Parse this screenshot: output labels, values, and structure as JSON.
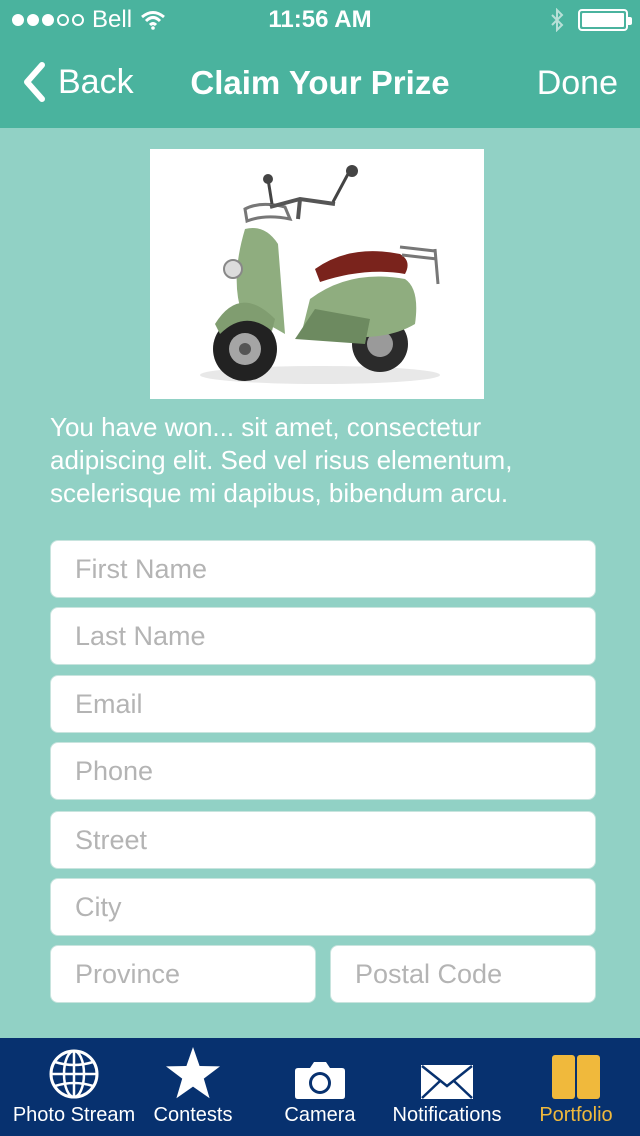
{
  "status_bar": {
    "carrier": "Bell",
    "time": "11:56 AM"
  },
  "nav": {
    "back_label": "Back",
    "title": "Claim Your Prize",
    "done_label": "Done"
  },
  "prize": {
    "description": "You have won... sit amet, consectetur adipiscing elit. Sed vel risus elementum, scelerisque mi dapibus, bibendum arcu."
  },
  "form": {
    "first_name_placeholder": "First Name",
    "last_name_placeholder": "Last Name",
    "email_placeholder": "Email",
    "phone_placeholder": "Phone",
    "street_placeholder": "Street",
    "city_placeholder": "City",
    "province_placeholder": "Province",
    "postal_code_placeholder": "Postal Code"
  },
  "tab_bar": {
    "tabs": [
      {
        "label": "Photo Stream",
        "icon": "globe-icon"
      },
      {
        "label": "Contests",
        "icon": "star-icon"
      },
      {
        "label": "Camera",
        "icon": "camera-icon"
      },
      {
        "label": "Notifications",
        "icon": "envelope-icon"
      },
      {
        "label": "Portfolio",
        "icon": "book-icon"
      }
    ],
    "active_tab": "Portfolio"
  },
  "colors": {
    "header": "#4ab39e",
    "background": "#91d1c5",
    "tab_bar": "#07316f",
    "active_tab": "#f0b93c"
  }
}
